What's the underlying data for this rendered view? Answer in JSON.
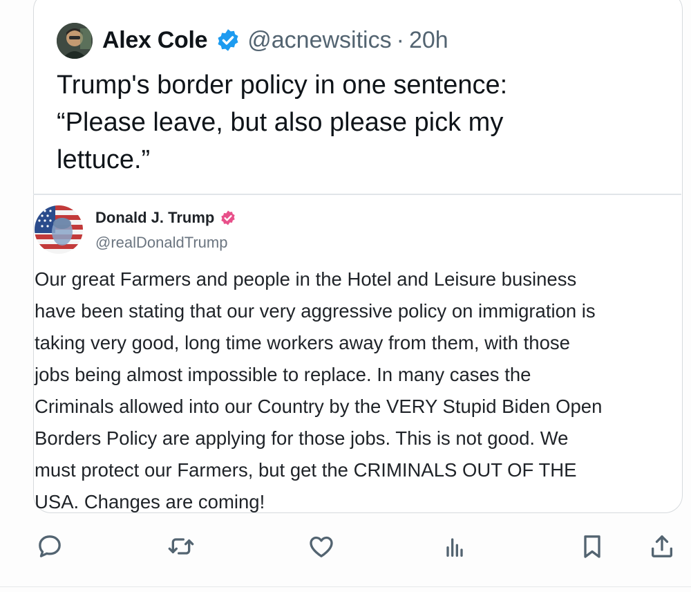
{
  "tweet": {
    "author_name": "Alex Cole",
    "handle": "@acnewsitics",
    "separator": "·",
    "time": "20h",
    "text_lines": [
      "Trump's border policy in one sentence:",
      "“Please leave, but also please pick my",
      "lettuce.”"
    ]
  },
  "quoted": {
    "author_name": "Donald J. Trump",
    "handle": "@realDonaldTrump",
    "text_lines": [
      "Our great Farmers and people in the Hotel and Leisure business",
      "have been stating that our very aggressive policy on immigration is",
      "taking very good, long time workers away from them, with those",
      "jobs being almost impossible to replace. In many cases the",
      "Criminals allowed into our Country by the VERY Stupid Biden Open",
      "Borders Policy are applying for those jobs. This is not good. We",
      "must protect our Farmers, but get the CRIMINALS OUT OF THE",
      "USA. Changes are coming!"
    ]
  },
  "actions": [
    {
      "name": "reply-icon"
    },
    {
      "name": "retweet-icon"
    },
    {
      "name": "like-icon"
    },
    {
      "name": "views-icon"
    },
    {
      "name": "bookmark-icon"
    },
    {
      "name": "share-icon"
    }
  ],
  "colors": {
    "verified_blue": "#1d9bf0",
    "verified_pink": "#e8508a",
    "action_icon": "#536471"
  }
}
